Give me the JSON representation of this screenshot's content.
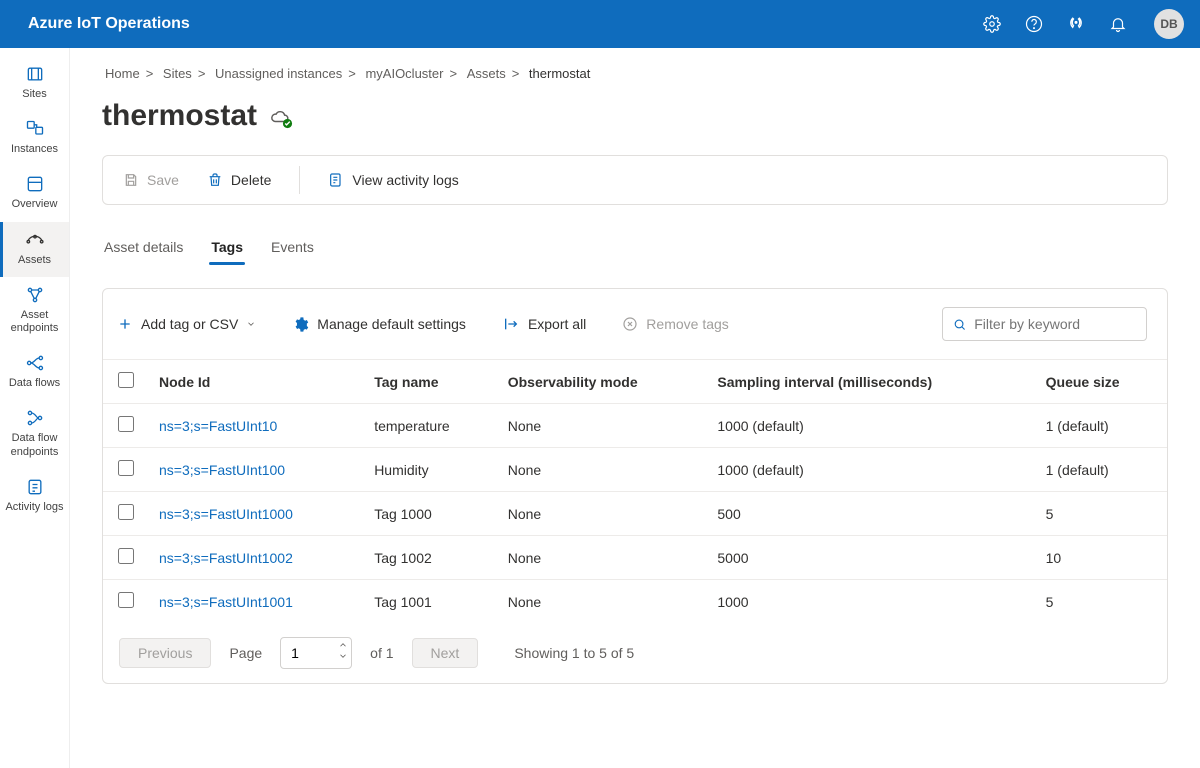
{
  "header": {
    "title": "Azure IoT Operations",
    "avatar": "DB"
  },
  "sidebar": [
    {
      "id": "sites",
      "label": "Sites"
    },
    {
      "id": "instances",
      "label": "Instances"
    },
    {
      "id": "overview",
      "label": "Overview"
    },
    {
      "id": "assets",
      "label": "Assets",
      "active": true
    },
    {
      "id": "asset-endpoints",
      "label": "Asset endpoints"
    },
    {
      "id": "data-flows",
      "label": "Data flows"
    },
    {
      "id": "data-flow-endpoints",
      "label": "Data flow endpoints"
    },
    {
      "id": "activity-logs",
      "label": "Activity logs"
    }
  ],
  "breadcrumb": {
    "items": [
      "Home",
      "Sites",
      "Unassigned instances",
      "myAIOcluster",
      "Assets"
    ],
    "current": "thermostat"
  },
  "page": {
    "title": "thermostat"
  },
  "actions": {
    "save": "Save",
    "delete": "Delete",
    "activity": "View activity logs"
  },
  "tabs": [
    {
      "id": "details",
      "label": "Asset details"
    },
    {
      "id": "tags",
      "label": "Tags",
      "active": true
    },
    {
      "id": "events",
      "label": "Events"
    }
  ],
  "toolbar": {
    "add": "Add tag or CSV",
    "manage": "Manage default settings",
    "export": "Export all",
    "remove": "Remove tags",
    "filter_placeholder": "Filter by keyword"
  },
  "table": {
    "headers": [
      "Node Id",
      "Tag name",
      "Observability mode",
      "Sampling interval (milliseconds)",
      "Queue size"
    ],
    "rows": [
      {
        "node": "ns=3;s=FastUInt10",
        "tag": "temperature",
        "obs": "None",
        "interval": "1000 (default)",
        "queue": "1 (default)"
      },
      {
        "node": "ns=3;s=FastUInt100",
        "tag": "Humidity",
        "obs": "None",
        "interval": "1000 (default)",
        "queue": "1 (default)"
      },
      {
        "node": "ns=3;s=FastUInt1000",
        "tag": "Tag 1000",
        "obs": "None",
        "interval": "500",
        "queue": "5"
      },
      {
        "node": "ns=3;s=FastUInt1002",
        "tag": "Tag 1002",
        "obs": "None",
        "interval": "5000",
        "queue": "10"
      },
      {
        "node": "ns=3;s=FastUInt1001",
        "tag": "Tag 1001",
        "obs": "None",
        "interval": "1000",
        "queue": "5"
      }
    ]
  },
  "pager": {
    "prev": "Previous",
    "next": "Next",
    "page_label": "Page",
    "page": "1",
    "of_label": "of 1",
    "showing": "Showing 1 to 5 of 5"
  }
}
